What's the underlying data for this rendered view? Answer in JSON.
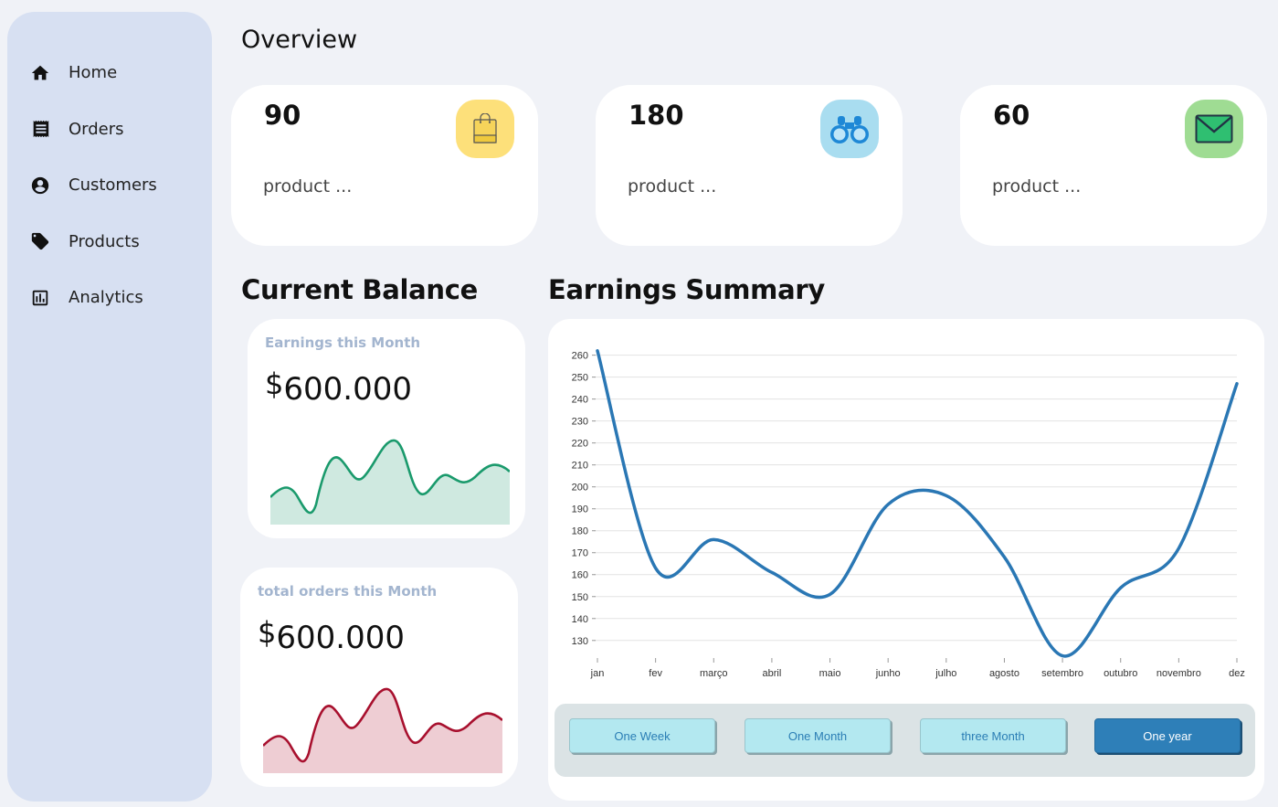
{
  "sidebar": {
    "items": [
      {
        "label": "Home",
        "icon": "home-icon"
      },
      {
        "label": "Orders",
        "icon": "receipt-icon"
      },
      {
        "label": "Customers",
        "icon": "account-circle-icon"
      },
      {
        "label": "Products",
        "icon": "tag-icon"
      },
      {
        "label": "Analytics",
        "icon": "bar-chart-icon"
      }
    ]
  },
  "header": {
    "title": "Overview"
  },
  "stats": [
    {
      "value": "90",
      "label": "product ...",
      "icon": "shopping-bag-icon",
      "color": "#fde07a"
    },
    {
      "value": "180",
      "label": "product ...",
      "icon": "binoculars-icon",
      "color": "#a9ddf0"
    },
    {
      "value": "60",
      "label": "product ...",
      "icon": "mail-icon",
      "color": "#9fdc93"
    }
  ],
  "balance": {
    "title": "Current Balance",
    "earnings": {
      "caption": "Earnings this Month",
      "currency": "$",
      "amount": "600.000",
      "color": "#1a9a6c"
    },
    "orders": {
      "caption": "total orders this Month",
      "currency": "$",
      "amount": "600.000",
      "color": "#a8102e"
    }
  },
  "earnings": {
    "title": "Earnings Summary"
  },
  "range": {
    "options": [
      "One Week",
      "One Month",
      "three Month",
      "One year"
    ],
    "selected": "One year"
  },
  "chart_data": {
    "type": "line",
    "categories": [
      "jan",
      "fev",
      "março",
      "abril",
      "maio",
      "junho",
      "julho",
      "agosto",
      "setembro",
      "outubro",
      "novembro",
      "dez"
    ],
    "series": [
      {
        "values": [
          262,
          163,
          176,
          161,
          151,
          192,
          196,
          168,
          123,
          154,
          172,
          247
        ],
        "color": "#2a77b4"
      }
    ],
    "y_ticks": [
      130,
      140,
      150,
      160,
      170,
      180,
      190,
      200,
      210,
      220,
      230,
      240,
      250,
      260
    ],
    "ylim": [
      122,
      264
    ],
    "grid": true,
    "legend": "none"
  }
}
